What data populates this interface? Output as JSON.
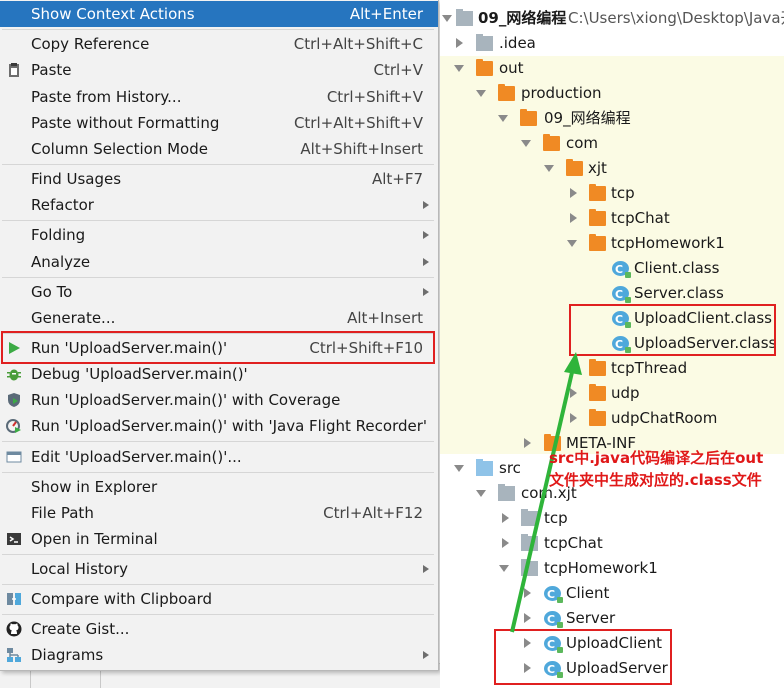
{
  "menu": {
    "items": [
      {
        "label": "Show Context Actions",
        "shortcut": "Alt+Enter",
        "icon": "",
        "submenu": false,
        "selected": true
      },
      {
        "label": "Copy Reference",
        "shortcut": "Ctrl+Alt+Shift+C",
        "icon": "",
        "submenu": false
      },
      {
        "label": "Paste",
        "shortcut": "Ctrl+V",
        "icon": "paste-icon",
        "submenu": false
      },
      {
        "label": "Paste from History...",
        "shortcut": "Ctrl+Shift+V",
        "icon": "",
        "submenu": false
      },
      {
        "label": "Paste without Formatting",
        "shortcut": "Ctrl+Alt+Shift+V",
        "icon": "",
        "submenu": false
      },
      {
        "label": "Column Selection Mode",
        "shortcut": "Alt+Shift+Insert",
        "icon": "",
        "submenu": false
      },
      {
        "label": "Find Usages",
        "shortcut": "Alt+F7",
        "icon": "",
        "submenu": false
      },
      {
        "label": "Refactor",
        "shortcut": "",
        "icon": "",
        "submenu": true
      },
      {
        "label": "Folding",
        "shortcut": "",
        "icon": "",
        "submenu": true
      },
      {
        "label": "Analyze",
        "shortcut": "",
        "icon": "",
        "submenu": true
      },
      {
        "label": "Go To",
        "shortcut": "",
        "icon": "",
        "submenu": true
      },
      {
        "label": "Generate...",
        "shortcut": "Alt+Insert",
        "icon": "",
        "submenu": false
      },
      {
        "label": "Run 'UploadServer.main()'",
        "shortcut": "Ctrl+Shift+F10",
        "icon": "run-icon",
        "submenu": false
      },
      {
        "label": "Debug 'UploadServer.main()'",
        "shortcut": "",
        "icon": "debug-icon",
        "submenu": false
      },
      {
        "label": "Run 'UploadServer.main()' with Coverage",
        "shortcut": "",
        "icon": "coverage-icon",
        "submenu": false
      },
      {
        "label": "Run 'UploadServer.main()' with 'Java Flight Recorder'",
        "shortcut": "",
        "icon": "profiler-icon",
        "submenu": false
      },
      {
        "label": "Edit 'UploadServer.main()'...",
        "shortcut": "",
        "icon": "edit-config-icon",
        "submenu": false
      },
      {
        "label": "Show in Explorer",
        "shortcut": "",
        "icon": "",
        "submenu": false
      },
      {
        "label": "File Path",
        "shortcut": "Ctrl+Alt+F12",
        "icon": "",
        "submenu": false
      },
      {
        "label": "Open in Terminal",
        "shortcut": "",
        "icon": "terminal-icon",
        "submenu": false
      },
      {
        "label": "Local History",
        "shortcut": "",
        "icon": "",
        "submenu": true
      },
      {
        "label": "Compare with Clipboard",
        "shortcut": "",
        "icon": "compare-icon",
        "submenu": false
      },
      {
        "label": "Create Gist...",
        "shortcut": "",
        "icon": "github-icon",
        "submenu": false
      },
      {
        "label": "Diagrams",
        "shortcut": "",
        "icon": "diagram-icon",
        "submenu": true
      }
    ]
  },
  "tree": {
    "root": {
      "name": "09_网络编程",
      "path": "C:\\Users\\xiong\\Desktop\\Java开"
    },
    "nodes": [
      {
        "name": ".idea",
        "kind": "folder-gray",
        "expanded": false
      },
      {
        "name": "out",
        "kind": "folder-orange",
        "expanded": true
      },
      {
        "name": "production",
        "kind": "folder-orange",
        "expanded": true
      },
      {
        "name": "09_网络编程",
        "kind": "folder-orange",
        "expanded": true
      },
      {
        "name": "com",
        "kind": "folder-orange",
        "expanded": true
      },
      {
        "name": "xjt",
        "kind": "folder-orange",
        "expanded": true
      },
      {
        "name": "tcp",
        "kind": "folder-orange",
        "expanded": false
      },
      {
        "name": "tcpChat",
        "kind": "folder-orange",
        "expanded": false
      },
      {
        "name": "tcpHomework1",
        "kind": "folder-orange",
        "expanded": true
      },
      {
        "name": "Client.class",
        "kind": "class"
      },
      {
        "name": "Server.class",
        "kind": "class"
      },
      {
        "name": "UploadClient.class",
        "kind": "class"
      },
      {
        "name": "UploadServer.class",
        "kind": "class"
      },
      {
        "name": "tcpThread",
        "kind": "folder-orange",
        "expanded": false
      },
      {
        "name": "udp",
        "kind": "folder-orange",
        "expanded": false
      },
      {
        "name": "udpChatRoom",
        "kind": "folder-orange",
        "expanded": false
      },
      {
        "name": "META-INF",
        "kind": "folder-orange",
        "expanded": false
      },
      {
        "name": "src",
        "kind": "folder-blue",
        "expanded": true
      },
      {
        "name": "com.xjt",
        "kind": "package",
        "expanded": true
      },
      {
        "name": "tcp",
        "kind": "package",
        "expanded": false
      },
      {
        "name": "tcpChat",
        "kind": "package",
        "expanded": false
      },
      {
        "name": "tcpHomework1",
        "kind": "package",
        "expanded": true
      },
      {
        "name": "Client",
        "kind": "class",
        "expanded": false
      },
      {
        "name": "Server",
        "kind": "class",
        "expanded": false
      },
      {
        "name": "UploadClient",
        "kind": "class",
        "expanded": false
      },
      {
        "name": "UploadServer",
        "kind": "class",
        "expanded": false
      }
    ]
  },
  "annotation": {
    "line1": "src中.java代码编译之后在out",
    "line2": "文件夹中生成对应的.class文件"
  },
  "colors": {
    "highlight": "#e02020",
    "selection": "#2675bf",
    "arrow": "#2fb43a"
  }
}
